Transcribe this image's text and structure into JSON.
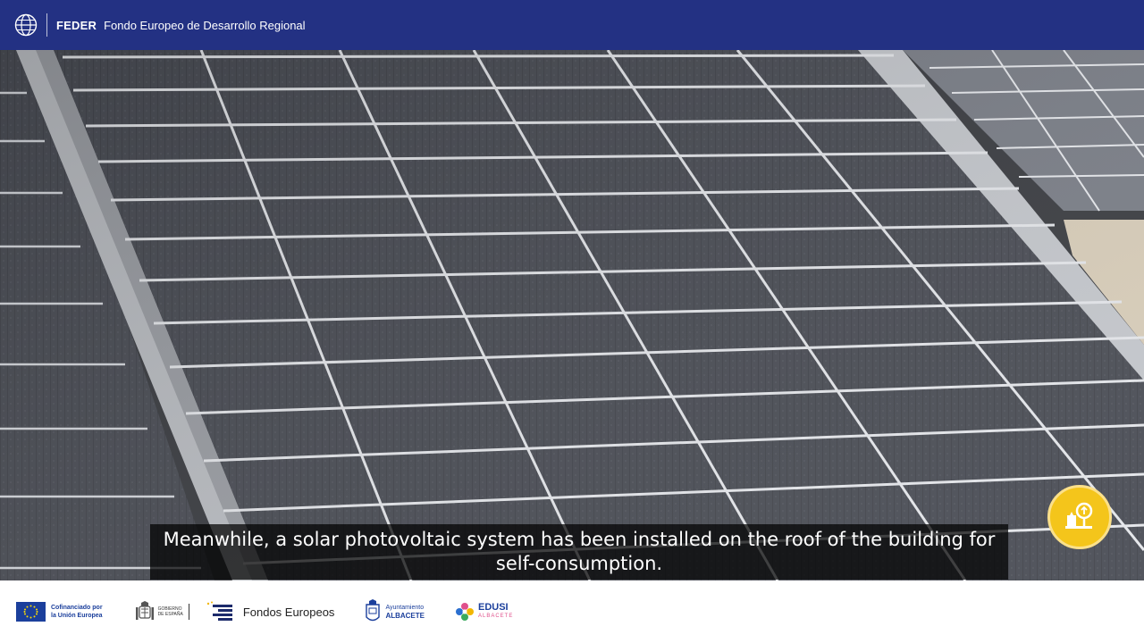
{
  "header": {
    "brand_short": "FEDER",
    "brand_full": "Fondo Europeo de Desarrollo Regional",
    "bar_color": "#233183"
  },
  "video": {
    "subtitle_line1": "Meanwhile, a solar photovoltaic system has been installed on the roof of the building for",
    "subtitle_line2": "self-consumption.",
    "badge_icon": "eco-building-icon",
    "badge_color": "#f4c51b"
  },
  "footer": {
    "eu_label_line1": "Cofinanciado por",
    "eu_label_line2": "la Unión Europea",
    "gobierno_line1": "GOBIERNO",
    "gobierno_line2": "DE ESPAÑA",
    "fondos_label": "Fondos Europeos",
    "ayto_line1": "Ayuntamiento",
    "ayto_line2": "ALBACETE",
    "edusi_label": "EDUSI",
    "edusi_sub": "ALBACETE"
  }
}
